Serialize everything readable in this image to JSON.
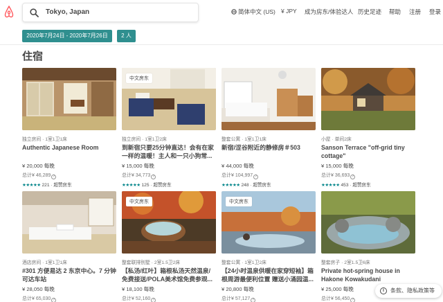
{
  "header": {
    "search_value": "Tokyo, Japan",
    "language": "简体中文 (US)",
    "currency": "¥ JPY",
    "become_host": "成为房东/体验达人",
    "history": "历史足迹",
    "help": "帮助",
    "signup": "注册",
    "login": "登录"
  },
  "filters": {
    "dates": "2020年7月24日 - 2020年7月26日",
    "guests": "2 人"
  },
  "section_title": "住宿",
  "colors": {
    "brand": "#FF5A5F",
    "filter": "#2f8f8f",
    "stars": "#008489"
  },
  "listings": [
    {
      "type": "独立房间 · 1室1卫1床",
      "title": "Authentic Japanese Room",
      "price": "¥ 20,000 每晚",
      "total": "总计¥ 46,289",
      "stars": "★★★★★",
      "reviews": "221",
      "superhost": "· 超赞房东",
      "badge": ""
    },
    {
      "type": "独立房间 · 1室1卫2床",
      "title": "到新宿只要25分钟直达！会有在家一样的温暖！主人和一只小狗常...",
      "price": "¥ 15,000 每晚",
      "total": "总计¥ 34,773",
      "stars": "★★★★★",
      "reviews": "125",
      "superhost": "· 超赞房东",
      "badge": "中文房东"
    },
    {
      "type": "整套公寓 · 1室1卫1床",
      "title": "新宿/涩谷附近的静修房＃503",
      "price": "¥ 44,000 每晚",
      "total": "总计¥ 104,997",
      "stars": "★★★★★",
      "reviews": "248",
      "superhost": "· 超赞房东",
      "badge": ""
    },
    {
      "type": "小屋 · 单间2床",
      "title": "Sanson Terrace \"off-grid tiny cottage\"",
      "price": "¥ 15,000 每晚",
      "total": "总计¥ 36,693",
      "stars": "★★★★★",
      "reviews": "453",
      "superhost": "· 超赞房东",
      "badge": ""
    },
    {
      "type": "酒店房间 · 1室1卫1床",
      "title": "#301 方便易达 2 东京中心。7 分钟可达车站",
      "price": "¥ 28,050 每晚",
      "total": "总计¥ 65,030",
      "stars": "★★★★★",
      "reviews": "",
      "superhost": "",
      "badge": ""
    },
    {
      "type": "整套联排别墅 · 2室1.5卫2床",
      "title": "【私汤/红叶】箱根私汤天然温泉/免费接送/POLA美术馆免费参观...",
      "price": "¥ 18,100 每晚",
      "total": "总计¥ 52,160",
      "stars": "★★★★★",
      "reviews": "",
      "superhost": "",
      "badge": "中文房东"
    },
    {
      "type": "整套公寓 · 1室1卫2床",
      "title": "【24小时温泉供暖在家穿短袖】箱根周游最便利位置 赠送小涌园温...",
      "price": "¥ 20,800 每晚",
      "total": "总计¥ 57,127",
      "stars": "★★★★★",
      "reviews": "",
      "superhost": "",
      "badge": "中文房东"
    },
    {
      "type": "整套房子 · 2室1.5卫6床",
      "title": "Private hot-spring house in Hakone Kowakudani",
      "price": "¥ 25,000 每晚",
      "total": "总计¥ 56,450",
      "stars": "★★★★★",
      "reviews": "",
      "superhost": "",
      "badge": ""
    }
  ],
  "cookie_notice": "条款、隐私政策等"
}
